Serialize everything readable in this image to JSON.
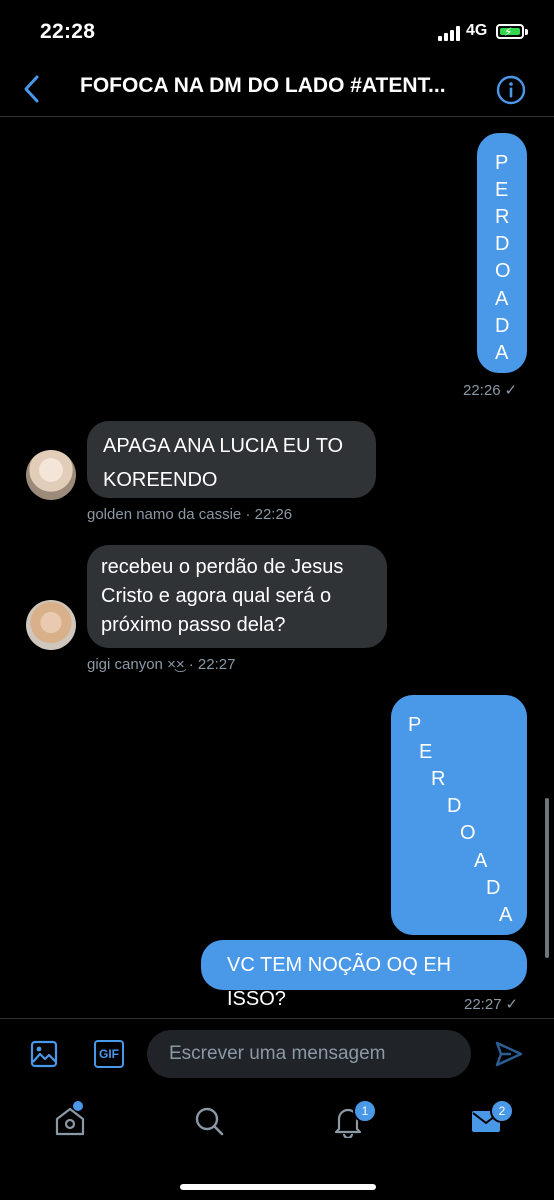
{
  "status_bar": {
    "time": "22:28",
    "network": "4G",
    "battery_charging": true
  },
  "header": {
    "title": "FOFOCA NA DM DO LADO #ATENT..."
  },
  "messages": [
    {
      "type": "outgoing",
      "vertical_letters": [
        "P",
        "E",
        "R",
        "D",
        "O",
        "A",
        "D",
        "A"
      ],
      "time": "22:26",
      "read": "✓"
    },
    {
      "type": "incoming",
      "text": "APAGA ANA LUCIA EU TO KOREENDO",
      "sender": "golden namo da cassie",
      "time": "· 22:26"
    },
    {
      "type": "incoming",
      "text": "recebeu o perdão de Jesus Cristo e agora qual será o próximo passo dela?",
      "sender": "gigi canyon",
      "sender_emoji": "×͜×",
      "time": "· 22:27"
    },
    {
      "type": "outgoing",
      "diagonal_letters": [
        "P",
        "E",
        "R",
        "D",
        "O",
        "A",
        "D",
        "A"
      ]
    },
    {
      "type": "outgoing",
      "text": "VC TEM NOÇÃO OQ EH ISSO?",
      "time": "22:27",
      "read": "✓"
    }
  ],
  "composer": {
    "placeholder": "Escrever uma mensagem",
    "gif_label": "GIF"
  },
  "tabbar": {
    "notifications_badge": "1",
    "messages_badge": "2"
  },
  "colors": {
    "accent": "#4a98e8",
    "bubble_incoming": "#2f3336",
    "background": "#000000",
    "meta_text": "#8b98a5"
  }
}
